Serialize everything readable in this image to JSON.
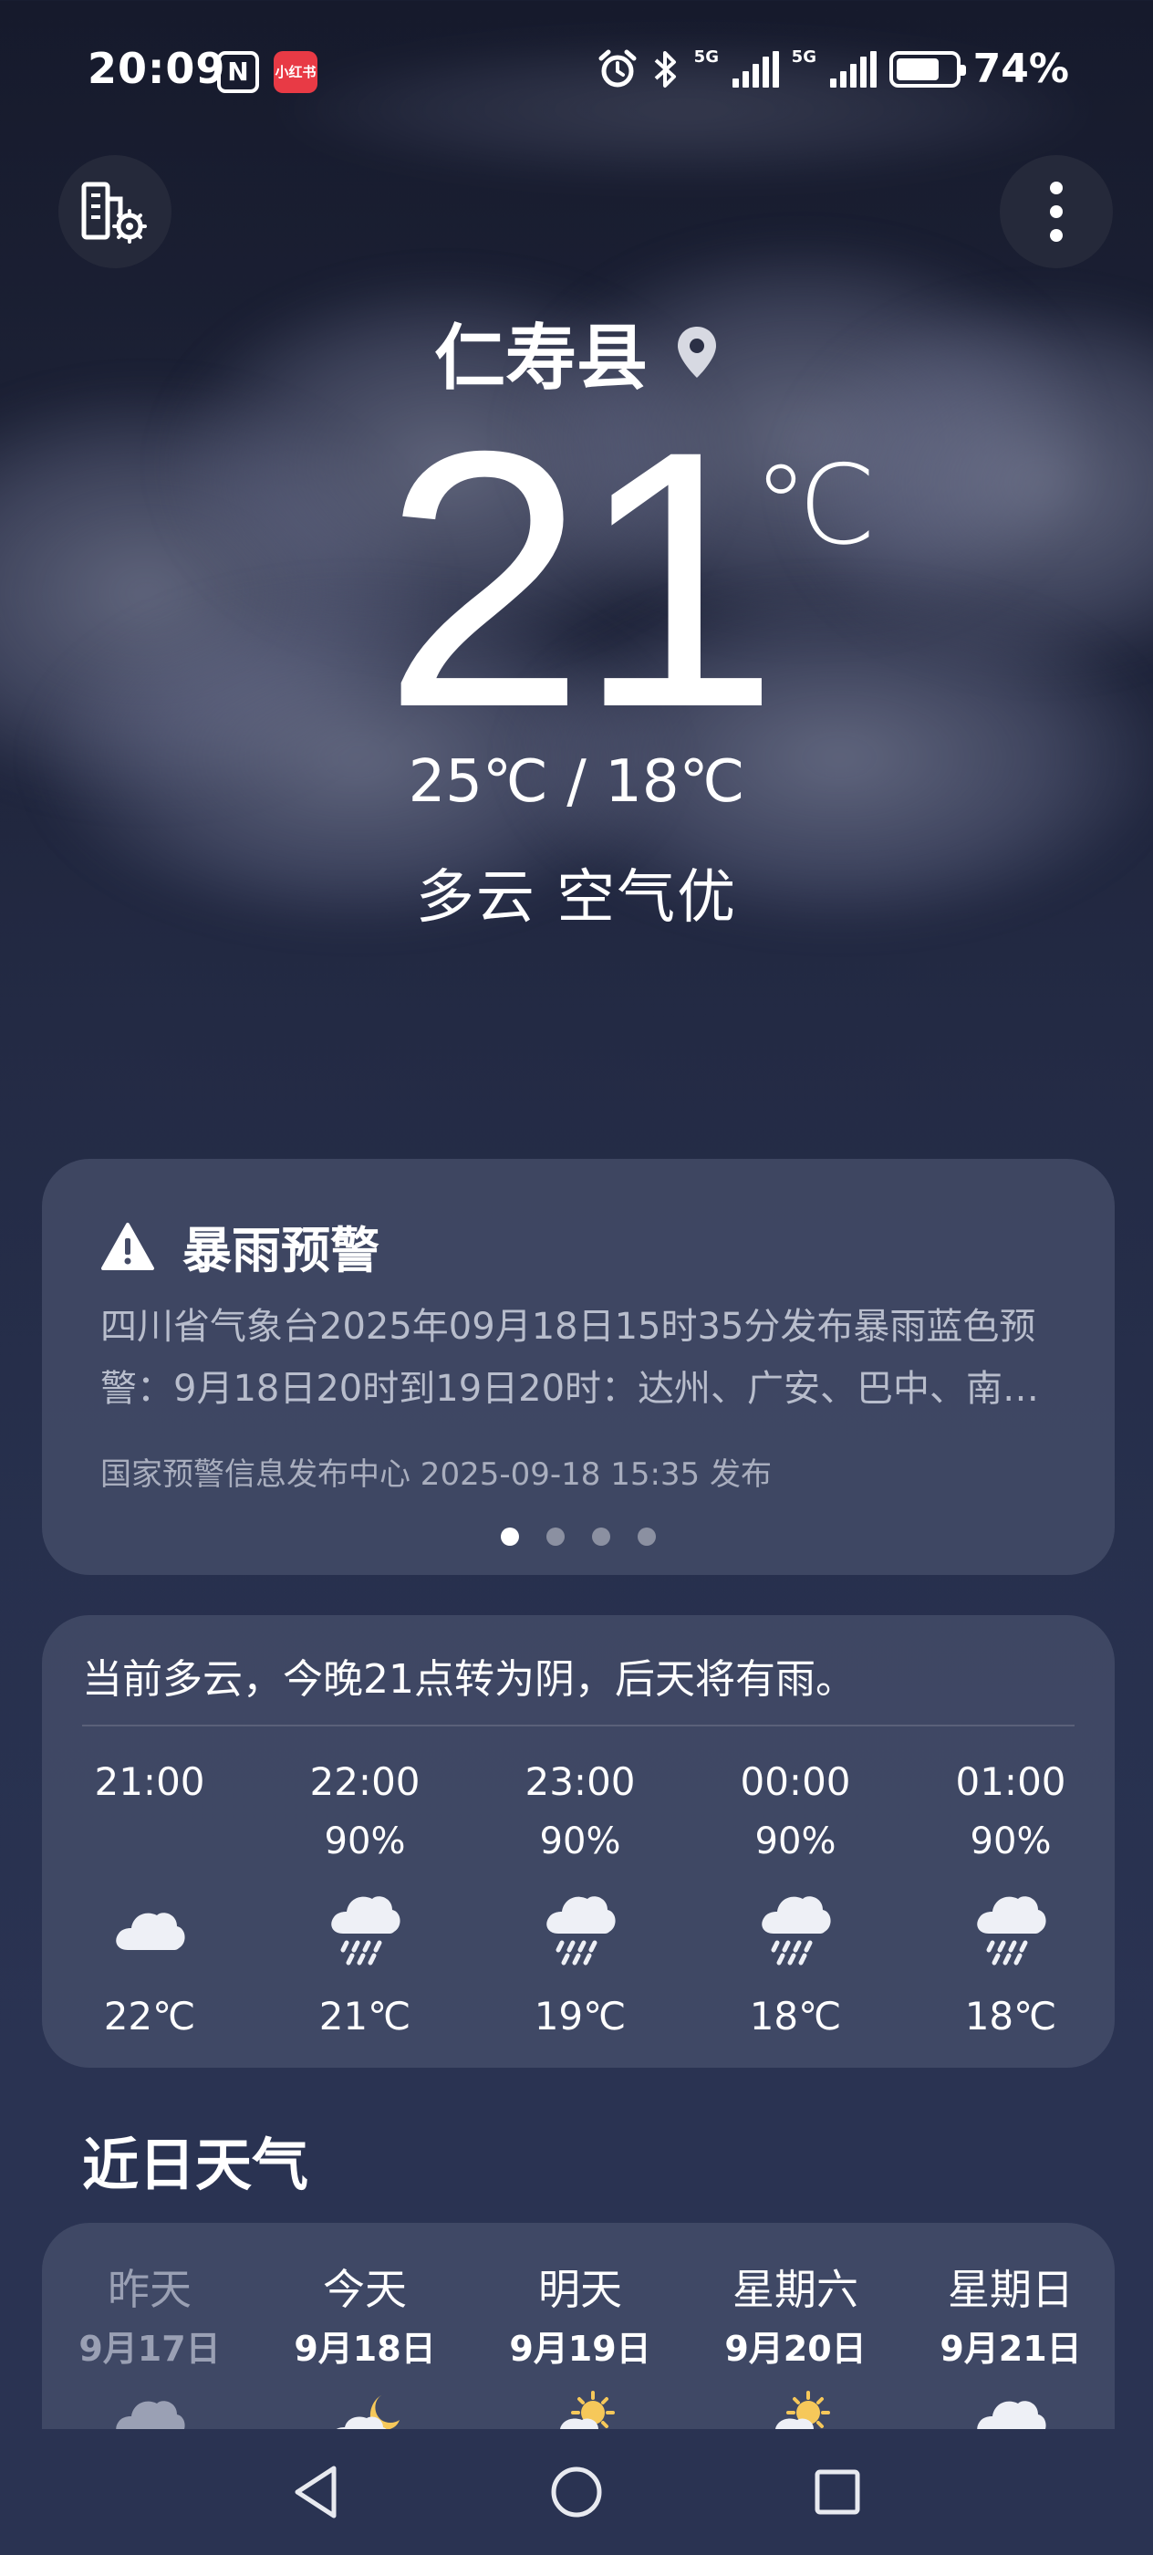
{
  "status_bar": {
    "time": "20:09",
    "nfc_icon": "nfc-icon",
    "app_badge": "小红书",
    "network_1": "5G",
    "network_2": "5G",
    "battery": "74%",
    "battery_level": 0.74
  },
  "header": {
    "city_manage_icon": "city-settings-icon",
    "more_icon": "more-vertical-icon"
  },
  "current": {
    "city": "仁寿县",
    "location_icon": "location-pin-icon",
    "temperature": "21",
    "unit": "℃",
    "range": "25℃ / 18℃",
    "condition": "多云  空气优"
  },
  "alert": {
    "icon": "warning-icon",
    "title": "暴雨预警",
    "body": "四川省气象台2025年09月18日15时35分发布暴雨蓝色预警：9月18日20时到19日20时：达州、广安、巴中、南…",
    "source": "国家预警信息发布中心 2025-09-18 15:35 发布",
    "pages": 4,
    "active_page": 0
  },
  "hourly": {
    "summary": "当前多云，今晚21点转为阴，后天将有雨。",
    "items": [
      {
        "time": "21:00",
        "pop": "",
        "icon": "cloudy-icon",
        "temp": "22℃"
      },
      {
        "time": "22:00",
        "pop": "90%",
        "icon": "rain-icon",
        "temp": "21℃"
      },
      {
        "time": "23:00",
        "pop": "90%",
        "icon": "rain-icon",
        "temp": "19℃"
      },
      {
        "time": "00:00",
        "pop": "90%",
        "icon": "rain-icon",
        "temp": "18℃"
      },
      {
        "time": "01:00",
        "pop": "90%",
        "icon": "rain-icon",
        "temp": "18℃"
      }
    ]
  },
  "recent": {
    "title": "近日天气",
    "days": [
      {
        "name": "昨天",
        "date": "9月17日",
        "icon": "cloudy-icon"
      },
      {
        "name": "今天",
        "date": "9月18日",
        "icon": "moon-cloud-icon"
      },
      {
        "name": "明天",
        "date": "9月19日",
        "icon": "sun-cloud-icon"
      },
      {
        "name": "星期六",
        "date": "9月20日",
        "icon": "sun-cloud-icon"
      },
      {
        "name": "星期日",
        "date": "9月21日",
        "icon": "cloudy-icon"
      }
    ]
  },
  "navbar": {
    "back_icon": "back-triangle-icon",
    "home_icon": "home-circle-icon",
    "recents_icon": "recents-square-icon"
  }
}
